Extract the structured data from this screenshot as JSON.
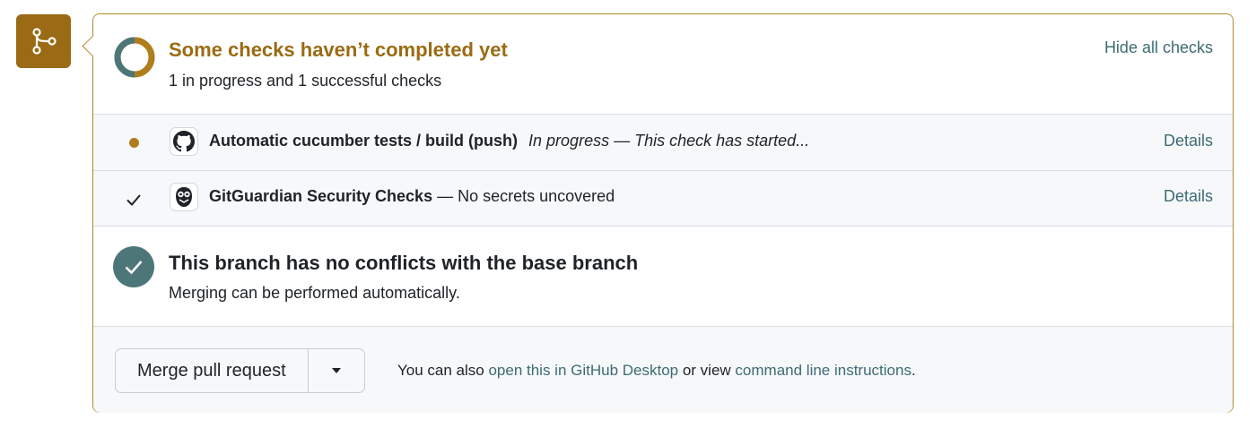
{
  "colors": {
    "accent": "#9a6b14",
    "link": "#3d6b73",
    "success": "#4d7678",
    "border": "#b58a2c"
  },
  "header": {
    "title": "Some checks haven’t completed yet",
    "subtitle": "1 in progress and 1 successful checks",
    "hide_link": "Hide all checks"
  },
  "checks": [
    {
      "name": "Automatic cucumber tests / build (push)",
      "status": "In progress — This check has started...",
      "state": "in-progress",
      "icon": "github-icon",
      "details": "Details"
    },
    {
      "name": "GitGuardian Security Checks",
      "status": "— No secrets uncovered",
      "state": "success",
      "icon": "gitguardian-icon",
      "details": "Details"
    }
  ],
  "branch": {
    "title": "This branch has no conflicts with the base branch",
    "subtitle": "Merging can be performed automatically."
  },
  "merge": {
    "button": "Merge pull request",
    "hint_prefix": "You can also ",
    "desktop_link": "open this in GitHub Desktop",
    "hint_mid": " or view ",
    "cli_link": "command line instructions",
    "hint_suffix": "."
  }
}
